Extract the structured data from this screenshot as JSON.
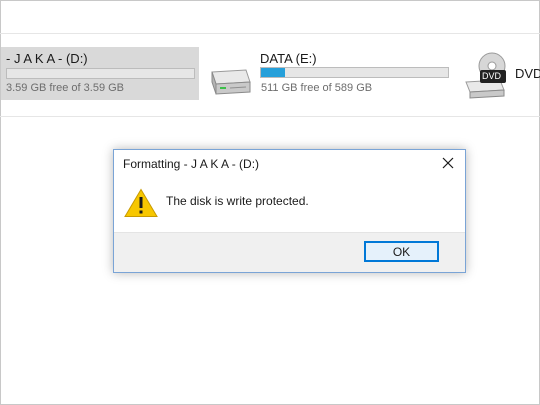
{
  "drives": [
    {
      "label": "- J A K A - (D:)",
      "free_text": "3.59 GB free of 3.59 GB",
      "used_fraction": 0.0,
      "selected": true,
      "icon": "removable-drive-icon"
    },
    {
      "label": "DATA (E:)",
      "free_text": "511 GB free of 589 GB",
      "used_fraction": 0.13,
      "selected": false,
      "icon": "hard-drive-icon"
    },
    {
      "label": "DVD",
      "badge": "DVD",
      "selected": false,
      "icon": "dvd-drive-icon"
    }
  ],
  "dialog": {
    "title": "Formatting - J A K A - (D:)",
    "message": "The disk is write protected.",
    "ok_label": "OK",
    "icon": "warning-icon",
    "close_icon": "close-icon"
  },
  "colors": {
    "accent": "#0078d7",
    "usage_bar": "#26a0da",
    "selection": "#d9d9d9",
    "warning": "#f7c700"
  }
}
